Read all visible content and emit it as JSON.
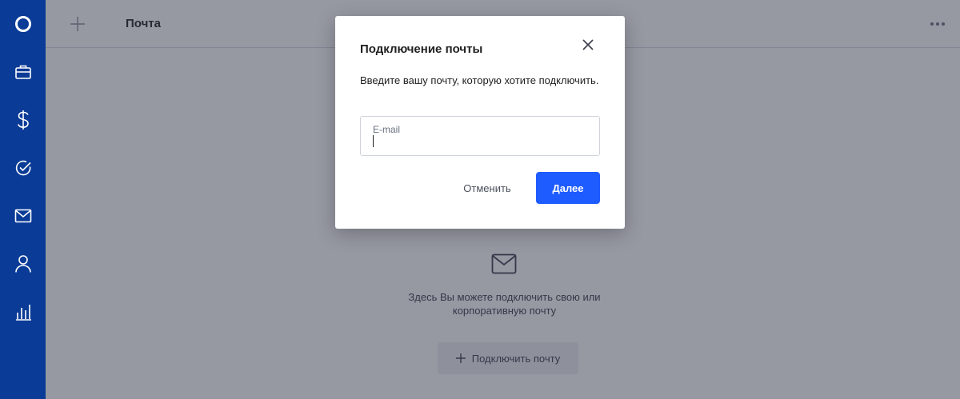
{
  "app": {
    "logo_icon": "ring-logo-icon"
  },
  "sidebar": {
    "items": [
      {
        "icon": "briefcase-icon"
      },
      {
        "icon": "dollar-icon"
      },
      {
        "icon": "check-circle-icon"
      },
      {
        "icon": "mail-icon"
      },
      {
        "icon": "person-icon"
      },
      {
        "icon": "bar-chart-icon"
      }
    ]
  },
  "header": {
    "title": "Почта"
  },
  "empty_state": {
    "text": "Здесь Вы можете подключить свою или корпоративную почту",
    "button_label": "Подключить почту"
  },
  "modal": {
    "title": "Подключение почты",
    "description": "Введите вашу почту, которую хотите подключить.",
    "email_label": "E-mail",
    "email_value": "",
    "cancel_label": "Отменить",
    "next_label": "Далее"
  },
  "colors": {
    "sidebar": "#0a3b96",
    "primary": "#1f5cff",
    "overlay": "rgba(45,50,70,0.5)"
  }
}
